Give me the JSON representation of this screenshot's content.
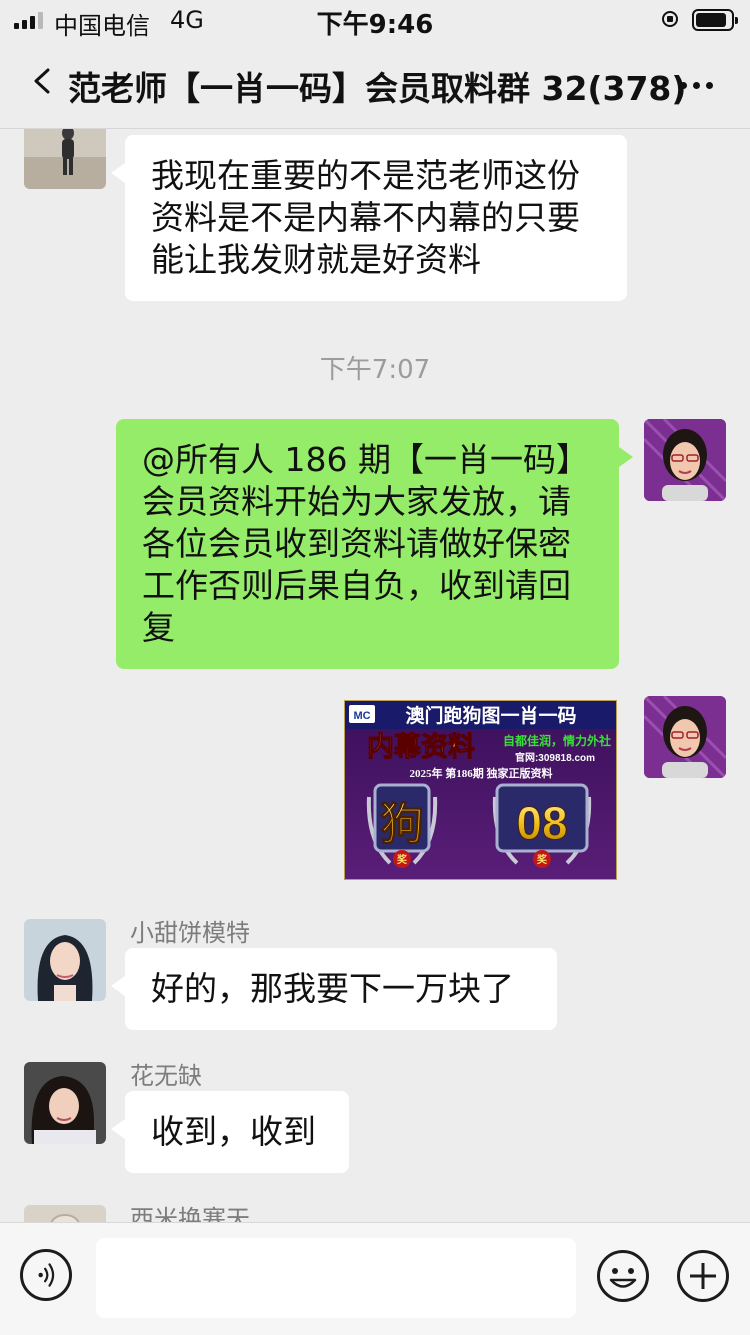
{
  "status": {
    "carrier": "中国电信",
    "network": "4G",
    "time": "下午9:46"
  },
  "header": {
    "title": "范老师【一肖一码】会员取料群 32(378)"
  },
  "messages": {
    "m1": {
      "direction": "incoming",
      "text": "我现在重要的不是范老师这份资料是不是内幕不内幕的只要能让我发财就是好资料"
    },
    "time_sep": "下午7:07",
    "m2": {
      "direction": "outgoing",
      "text": "@所有人 186 期【一肖一码】会员资料开始为大家发放，请各位会员收到资料请做好保密工作否则后果自负，收到请回复"
    },
    "m3": {
      "direction": "outgoing",
      "image": {
        "logo_text": "MC",
        "title": "澳门跑狗图一肖一码",
        "subtitle": "内幕资料",
        "slogan": "自都佳润，情力外社",
        "site": "官网:309818.com",
        "info_line": "2025年  第186期  独家正版资料",
        "zodiac": "狗",
        "number": "08",
        "badge_char": "奖"
      }
    },
    "m4": {
      "direction": "incoming",
      "sender": "小甜饼模特",
      "text": "好的，那我要下一万块了"
    },
    "m5": {
      "direction": "incoming",
      "sender": "花无缺",
      "text": "收到，收到"
    },
    "m6": {
      "direction": "incoming",
      "sender": "西米换寒天"
    }
  },
  "input_bar": {
    "placeholder": ""
  },
  "colors": {
    "background": "#ededed",
    "outgoing_bubble": "#95ec69",
    "incoming_bubble": "#ffffff",
    "timestamp_text": "#9c9c9c",
    "sender_text": "#7d7d7d"
  },
  "icons": {
    "back": "chevron-left-icon",
    "more": "more-dots-icon",
    "voice": "voice-icon",
    "emoji": "emoji-icon",
    "plus": "plus-icon"
  }
}
